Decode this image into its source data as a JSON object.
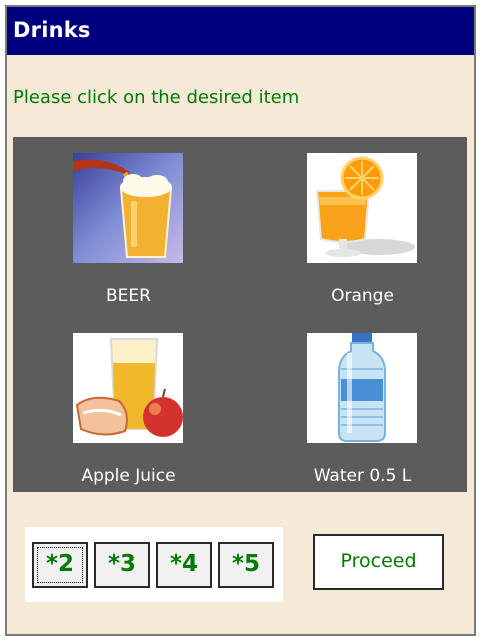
{
  "window": {
    "title": "Drinks"
  },
  "instruction": "Please click on the desired item",
  "items": [
    {
      "label": "BEER",
      "icon": "beer-glass-image"
    },
    {
      "label": "Orange",
      "icon": "orange-juice-image"
    },
    {
      "label": "Apple Juice",
      "icon": "apple-juice-image"
    },
    {
      "label": "Water 0.5 L",
      "icon": "water-bottle-image"
    }
  ],
  "pager": {
    "pages": [
      "*2",
      "*3",
      "*4",
      "*5"
    ],
    "selected": "*2"
  },
  "proceed_label": "Proceed",
  "colors": {
    "title_bar": "#00007f",
    "window_bg": "#f5ead8",
    "panel_bg": "#5c5c5c",
    "accent_text": "#007a00"
  }
}
